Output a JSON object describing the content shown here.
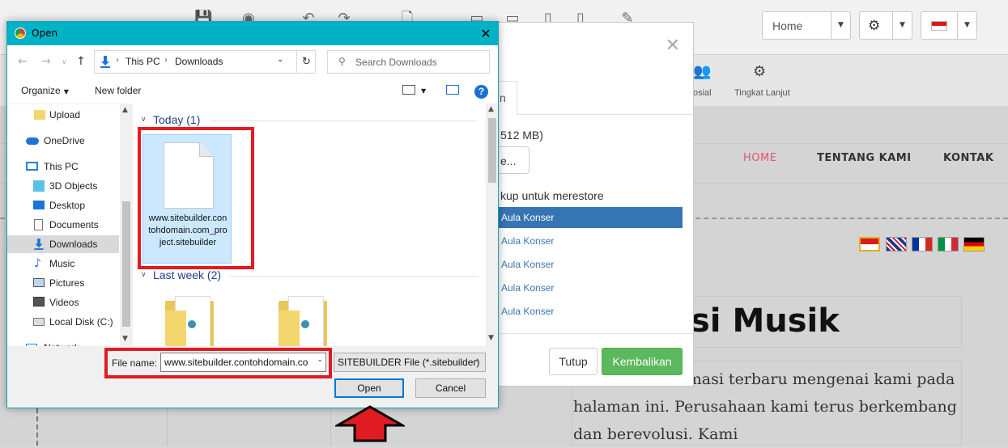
{
  "site": {
    "page_select": "Home",
    "toolbar2": {
      "social_label": "osial",
      "advanced_label": "Tingkat Lanjut"
    },
    "nav": [
      "HOME",
      "TENTANG KAMI",
      "KONTAK"
    ],
    "hero_title": "si Musik",
    "paragraph": "nemukan informasi terbaru mengenai kami pada halaman ini. Perusahaan kami terus berkembang dan berevolusi. Kami",
    "colors": {
      "active_nav": "#e0566a"
    }
  },
  "restore_modal": {
    "tab_label": "n",
    "size_text": "512 MB)",
    "browse_label": "e...",
    "backup_prompt": "kup untuk merestore",
    "backups": [
      "Aula Konser",
      "Aula Konser",
      "Aula Konser",
      "Aula Konser",
      "Aula Konser"
    ],
    "close_label": "Tutup",
    "restore_label": "Kembalikan",
    "colors": {
      "restore_button": "#5cb85c",
      "selected_backup": "#3675b3"
    }
  },
  "open_dialog": {
    "title": "Open",
    "address": {
      "root": "This PC",
      "folder": "Downloads"
    },
    "search_placeholder": "Search Downloads",
    "commands": {
      "organize": "Organize",
      "new_folder": "New folder"
    },
    "nav_items": [
      {
        "label": "Upload",
        "icon": "folder-icon"
      },
      {
        "label": "OneDrive",
        "icon": "cloud-icon"
      },
      {
        "label": "This PC",
        "icon": "computer-icon"
      },
      {
        "label": "3D Objects",
        "icon": "cube-icon"
      },
      {
        "label": "Desktop",
        "icon": "desktop-icon"
      },
      {
        "label": "Documents",
        "icon": "document-icon"
      },
      {
        "label": "Downloads",
        "icon": "download-icon"
      },
      {
        "label": "Music",
        "icon": "music-icon"
      },
      {
        "label": "Pictures",
        "icon": "pictures-icon"
      },
      {
        "label": "Videos",
        "icon": "videos-icon"
      },
      {
        "label": "Local Disk (C:)",
        "icon": "drive-icon"
      },
      {
        "label": "Network",
        "icon": "network-icon"
      }
    ],
    "groups": [
      {
        "header": "Today (1)"
      },
      {
        "header": "Last week (2)"
      }
    ],
    "file_name_tile": "www.sitebuilder.contohdomain.com_project.sitebuilder",
    "file_name_label": "File name:",
    "file_name_value": "www.sitebuilder.contohdomain.com_project.sitebuilder",
    "file_type": "SITEBUILDER File (*.sitebuilder)",
    "open_label": "Open",
    "cancel_label": "Cancel",
    "colors": {
      "title_bar": "#00b2c5",
      "highlight": "#e11b22",
      "group_header": "#1e3e8a"
    }
  }
}
